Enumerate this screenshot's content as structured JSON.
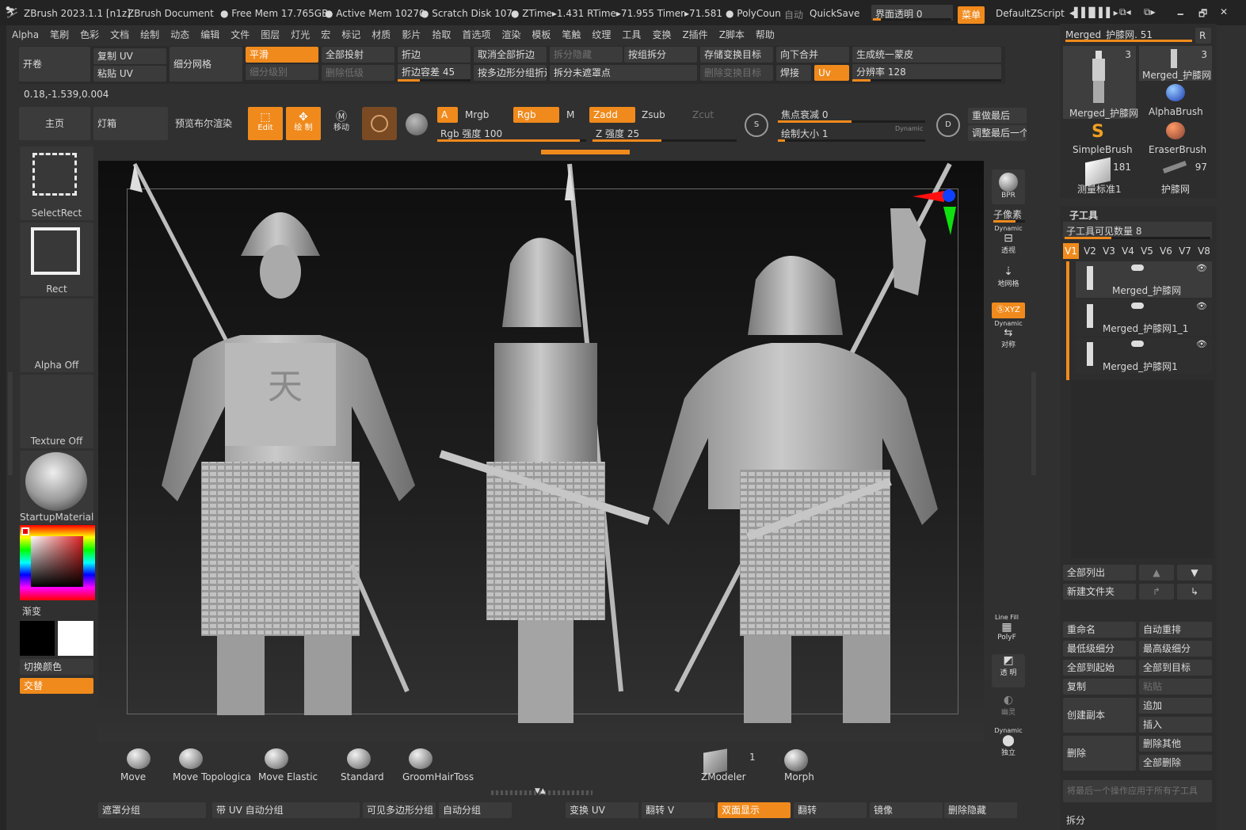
{
  "titlebar": {
    "app": "ZBrush 2023.1.1 [n1z]",
    "doc": "ZBrush Document",
    "freemem": "Free Mem 17.765GB",
    "activemem": "Active Mem 10270",
    "scratch": "Scratch Disk 107",
    "ztime": "ZTime▸1.431 RTime▸71.955 Timer▸71.581",
    "polycount": "PolyCoun",
    "auto": "自动",
    "quicksave": "QuickSave",
    "ui_alpha": "界面透明 0",
    "menu": "菜单",
    "script": "DefaultZScript"
  },
  "menubar": [
    "Alpha",
    "笔刷",
    "色彩",
    "文档",
    "绘制",
    "动态",
    "编辑",
    "文件",
    "图层",
    "灯光",
    "宏",
    "标记",
    "材质",
    "影片",
    "拾取",
    "首选项",
    "渲染",
    "模板",
    "笔触",
    "纹理",
    "工具",
    "变换",
    "Z插件",
    "Z脚本",
    "帮助"
  ],
  "shelf": {
    "open": "开卷",
    "copy_uv": "复制 UV",
    "paste_uv": "粘贴 UV",
    "subdiv_grid": "细分网格",
    "smooth": "平滑",
    "subdiv_level": "细分级别",
    "project_all": "全部投射",
    "delete_lower": "删除低级",
    "crease": "折边",
    "crease_tol": "折边容差 45",
    "uncrease_all": "取消全部折边",
    "crease_pg": "按多边形分组折边",
    "split_hidden": "拆分隐藏",
    "split_unmasked": "拆分未遮罩点",
    "group_split": "按组拆分",
    "store_morph": "存储变换目标",
    "delete_morph": "删除变换目标",
    "merge_down": "向下合并",
    "weld": "焊接",
    "uv": "Uv",
    "unify_skin": "生成统一蒙皮",
    "resolution": "分辨率 128"
  },
  "coords": "0.18,-1.539,0.004",
  "toolbar": {
    "home": "主页",
    "lightbox": "灯箱",
    "preview_bool": "预览布尔渲染",
    "edit": "Edit",
    "draw": "绘 制",
    "move": "移动",
    "a": "A",
    "mrgb": "Mrgb",
    "rgb": "Rgb",
    "m": "M",
    "zadd": "Zadd",
    "zsub": "Zsub",
    "zcut": "Zcut",
    "rgb_intensity": "Rgb 强度 100",
    "z_intensity": "Z 强度 25",
    "focal_shift": "焦点衰减 0",
    "draw_size": "绘制大小 1",
    "dynamic": "Dynamic",
    "redo_last": "重做最后",
    "adjust_last": "调整最后一个"
  },
  "left": {
    "selectrect": "SelectRect",
    "rect": "Rect",
    "alpha_off": "Alpha Off",
    "texture_off": "Texture Off",
    "material": "StartupMaterial",
    "gradient": "渐变",
    "switch_color": "切换颜色",
    "alternate": "交替"
  },
  "righticons": {
    "bpr": "BPR",
    "subpixel": "子像素",
    "dynamic": "Dynamic",
    "persp": "透视",
    "floor": "地网格",
    "xyz": "ⓈXYZ",
    "sym": "对称",
    "linefill": "Line Fill",
    "polyf": "PolyF",
    "transp": "透 明",
    "ghost": "幽灵",
    "solo": "独立"
  },
  "tool": {
    "name": "Merged_护膝网. 51",
    "r": "R",
    "thumb1": "Merged_护膝网",
    "thumb1_count": "3",
    "thumb2": "Merged_护膝网",
    "thumb2_count": "3",
    "alphabrush": "AlphaBrush",
    "simplebrush": "SimpleBrush",
    "eraserbrush": "EraserBrush",
    "measure": "测量标准1",
    "measure_count": "181",
    "kneenet": "护膝网",
    "kneenet_count": "97"
  },
  "subtool": {
    "title": "子工具",
    "visible": "子工具可见数量 8",
    "versions": [
      "V1",
      "V2",
      "V3",
      "V4",
      "V5",
      "V6",
      "V7",
      "V8"
    ],
    "items": [
      "Merged_护膝网",
      "Merged_护膝网1_1",
      "Merged_护膝网1"
    ],
    "list_all": "全部列出",
    "new_folder": "新建文件夹",
    "rename": "重命名",
    "auto_reorder": "自动重排",
    "lowest": "最低级细分",
    "highest": "最高级细分",
    "all_start": "全部到起始",
    "all_target": "全部到目标",
    "copy": "复制",
    "paste": "粘贴",
    "duplicate": "创建副本",
    "append": "追加",
    "insert": "插入",
    "delete": "删除",
    "delete_other": "删除其他",
    "delete_all": "全部删除",
    "apply_all": "将最后一个操作应用于所有子工具",
    "split": "拆分"
  },
  "brushes": [
    "Move",
    "Move Topologica",
    "Move Elastic",
    "Standard",
    "GroomHairToss"
  ],
  "brushes2": {
    "zmodeler": "ZModeler",
    "zmodeler_count": "1",
    "morph": "Morph"
  },
  "bottom": [
    "遮罩分组",
    "带 UV 自动分组",
    "可见多边形分组",
    "自动分组",
    "变换 UV",
    "翻转 V",
    "双面显示",
    "翻转",
    "镜像",
    "删除隐藏"
  ],
  "colors": {
    "accent": "#f08a1c",
    "panel": "#383838",
    "bg": "#303030"
  }
}
